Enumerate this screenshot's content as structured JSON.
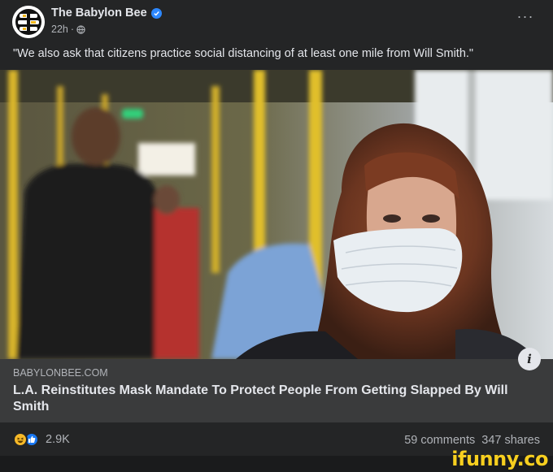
{
  "post": {
    "page_name": "The Babylon Bee",
    "time": "22h",
    "separator": "·",
    "caption": "\"We also ask that citizens practice social distancing of at least one mile from Will Smith.\"",
    "more_label": "···"
  },
  "link": {
    "domain": "BABYLONBEE.COM",
    "headline": "L.A. Reinstitutes Mask Mandate To Protect People From Getting Slapped By Will Smith",
    "info_label": "i"
  },
  "stats": {
    "reaction_count": "2.9K",
    "comments": "59 comments",
    "shares": "347 shares"
  },
  "watermark": "ifunny.co",
  "colors": {
    "background": "#242526",
    "link_panel": "#3a3b3c",
    "verified": "#2d88ff",
    "like": "#1877f2",
    "haha": "#f7b928",
    "watermark": "#f7cf1f"
  },
  "icons": {
    "avatar": "babylon-bee-logo-icon",
    "verified": "verified-check-icon",
    "privacy": "globe-icon",
    "reactions": [
      "haha-icon",
      "like-icon"
    ]
  }
}
